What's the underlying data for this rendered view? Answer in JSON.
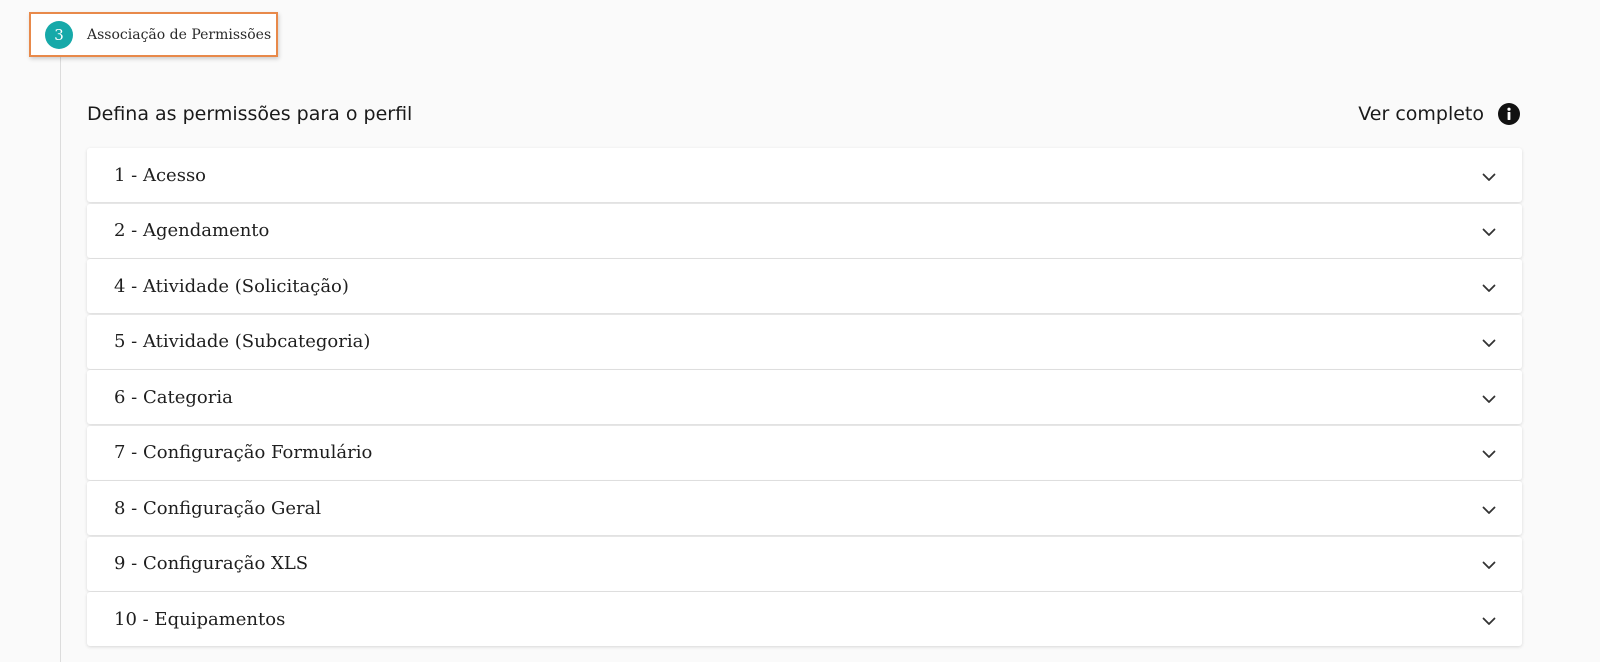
{
  "step": {
    "number": "3",
    "label": "Associação de Permissões",
    "border_color": "#e8894a",
    "badge_color": "#16a9a9"
  },
  "header": {
    "title": "Defina as permissões para o perfil",
    "view_full_label": "Ver completo",
    "view_full_icon": "info-icon"
  },
  "accordion": {
    "expand_icon": "chevron-down-icon",
    "items": [
      {
        "label": "1 - Acesso"
      },
      {
        "label": "2 - Agendamento"
      },
      {
        "label": "4 - Atividade (Solicitação)"
      },
      {
        "label": "5 - Atividade (Subcategoria)"
      },
      {
        "label": "6 - Categoria"
      },
      {
        "label": "7 - Configuração Formulário"
      },
      {
        "label": "8 - Configuração Geral"
      },
      {
        "label": "9 - Configuração XLS"
      },
      {
        "label": "10 - Equipamentos"
      }
    ]
  }
}
